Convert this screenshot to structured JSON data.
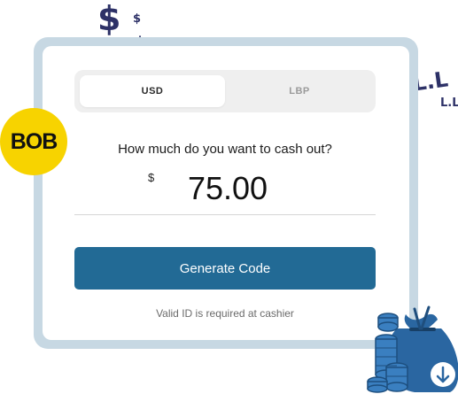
{
  "segmented": {
    "options": [
      "USD",
      "LBP"
    ],
    "selected": "USD"
  },
  "form": {
    "question": "How much do you want to cash out?",
    "currency_symbol": "$",
    "amount": "75.00"
  },
  "actions": {
    "generate_label": "Generate Code"
  },
  "note": "Valid ID is required at cashier",
  "brand": {
    "logo_text": "BOB",
    "logo_color": "#f7d300"
  },
  "decorations": {
    "dollar_large": "$",
    "dollar_small": "$",
    "dollar_medium": "$",
    "lbp_large": "L.L",
    "lbp_small": "L.L"
  },
  "colors": {
    "accent": "#226a95",
    "frame": "#c7d8e3",
    "deco": "#2d3167"
  }
}
